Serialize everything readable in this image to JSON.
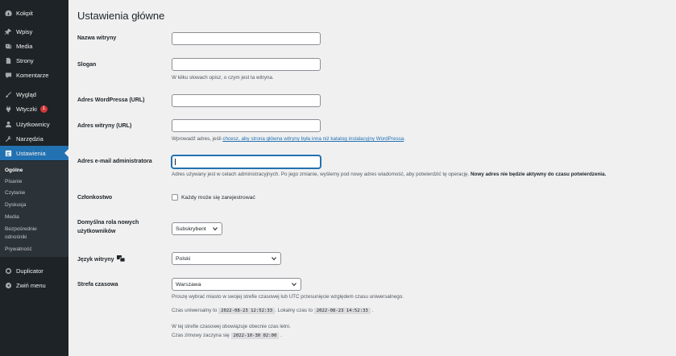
{
  "sidebar": {
    "menu": [
      {
        "label": "Kokpit",
        "icon": "dashboard-icon"
      },
      {
        "label": "Wpisy",
        "icon": "pin-icon"
      },
      {
        "label": "Media",
        "icon": "media-icon"
      },
      {
        "label": "Strony",
        "icon": "page-icon"
      },
      {
        "label": "Komentarze",
        "icon": "comment-icon"
      },
      {
        "label": "Wygląd",
        "icon": "brush-icon"
      },
      {
        "label": "Wtyczki",
        "icon": "plugin-icon",
        "badge": "1"
      },
      {
        "label": "Użytkownicy",
        "icon": "users-icon"
      },
      {
        "label": "Narzędzia",
        "icon": "wrench-icon"
      },
      {
        "label": "Ustawienia",
        "icon": "settings-icon"
      },
      {
        "label": "Duplicator",
        "icon": "duplicator-icon"
      },
      {
        "label": "Zwiń menu",
        "icon": "collapse-icon"
      }
    ],
    "submenu": [
      "Ogólne",
      "Pisanie",
      "Czytanie",
      "Dyskusja",
      "Media",
      "Bezpośrednie",
      "odnośniki",
      "Prywatność"
    ]
  },
  "main": {
    "title": "Ustawienia główne",
    "fields": {
      "site_name": {
        "label": "Nazwa witryny",
        "value": ""
      },
      "tagline": {
        "label": "Slogan",
        "value": "",
        "desc": "W kilku słowach opisz, o czym jest ta witryna."
      },
      "wp_url": {
        "label": "Adres WordPressa (URL)",
        "value": ""
      },
      "site_url": {
        "label": "Adres witryny (URL)",
        "value": "",
        "desc_before": "Wprowadź adres, jeśli ",
        "desc_link": "chcesz, aby strona główna witryny była inna niż katalog instalacyjny WordPressa",
        "desc_after": "."
      },
      "admin_email": {
        "label": "Adres e-mail administratora",
        "value": "",
        "desc": "Adres używany jest w celach administracyjnych. Po jego zmianie, wyślemy pod nowy adres wiadomość, aby potwierdzić tę operację. ",
        "desc_bold": "Nowy adres nie będzie aktywny do czasu potwierdzenia."
      },
      "membership": {
        "label": "Członkostwo",
        "checkbox_label": "Każdy może się zarejestrować",
        "checked": false
      },
      "default_role": {
        "label_line1": "Domyślna rola nowych",
        "label_line2": "użytkowników",
        "value": "Subskrybent"
      },
      "language": {
        "label": "Język witryny",
        "value": "Polski"
      },
      "timezone": {
        "label": "Strefa czasowa",
        "value": "Warszawa",
        "desc": "Proszę wybrać miasto w swojej strefie czasowej lub UTC przesunięcie względem czasu uniwersalnego.",
        "utc_prefix": "Czas uniwersalny to",
        "utc_time": "2022-08-23 12:52:33",
        "local_prefix": ". Lokalny czas to",
        "local_time": "2022-08-23 14:52:33",
        "end_dot": ".",
        "dst_line": "W tej strefie czasowej obowiązuje obecnie czas letni.",
        "winter_prefix": "Czas zimowy zaczyna się",
        "winter_time": "2022-10-30 02:00",
        "winter_suffix": "."
      }
    }
  }
}
